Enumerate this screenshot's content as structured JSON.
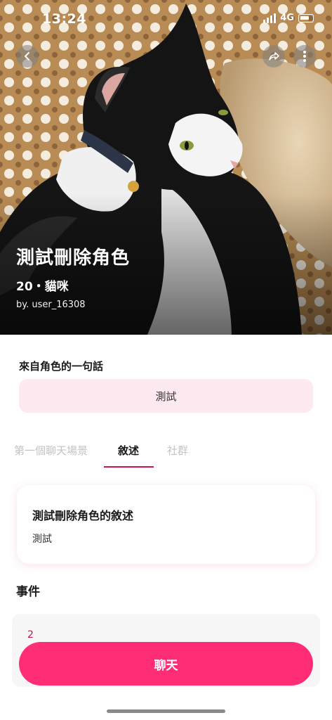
{
  "status_bar": {
    "time": "13:24",
    "network": "4G"
  },
  "hero": {
    "photo_description_icon": "cat-photo",
    "name": "測試刪除角色",
    "meta": "20・貓咪",
    "author": "by. user_16308"
  },
  "quote": {
    "heading": "來自角色的一句話",
    "text": "測試"
  },
  "tabs": [
    {
      "label": "第一個聊天場景",
      "active": false
    },
    {
      "label": "敘述",
      "active": true
    },
    {
      "label": "社群",
      "active": false
    }
  ],
  "description": {
    "title": "測試刪除角色的敘述",
    "body": "測試"
  },
  "events": {
    "heading": "事件",
    "count": "2"
  },
  "actions": {
    "chat_label": "聊天"
  },
  "colors": {
    "accent": "#ff2d78",
    "tab_underline": "#c8144f",
    "quote_bg": "#fdeaf1"
  }
}
